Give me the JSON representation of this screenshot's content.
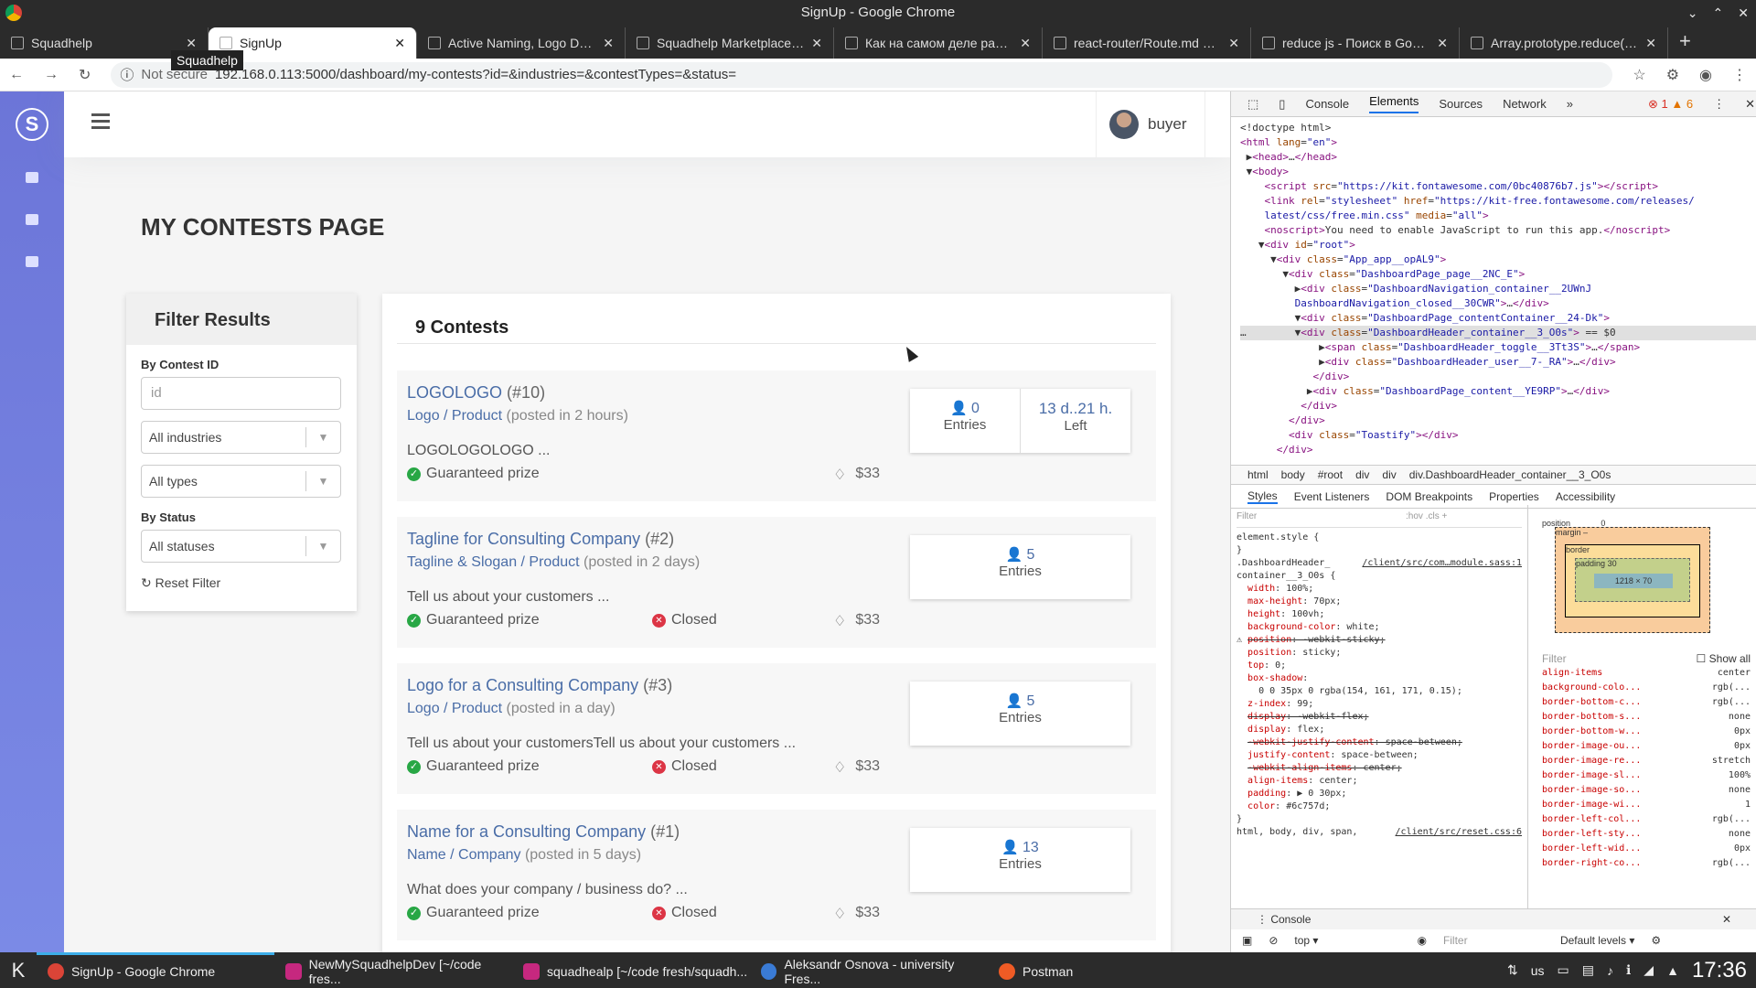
{
  "window": {
    "title": "SignUp - Google Chrome"
  },
  "tabs": [
    {
      "label": "Squadhelp"
    },
    {
      "label": "SignUp"
    },
    {
      "label": "Active Naming, Logo Desig"
    },
    {
      "label": "Squadhelp Marketplace Lis"
    },
    {
      "label": "Как на самом деле работа"
    },
    {
      "label": "react-router/Route.md at m"
    },
    {
      "label": "reduce js - Поиск в Google"
    },
    {
      "label": "Array.prototype.reduce() - J"
    }
  ],
  "tooltip": "Squadhelp",
  "address": {
    "security": "Not secure",
    "url": "192.168.0.113:5000/dashboard/my-contests?id=&industries=&contestTypes=&status="
  },
  "header": {
    "user": "buyer"
  },
  "page": {
    "title": "MY CONTESTS PAGE"
  },
  "filter": {
    "title": "Filter Results",
    "by_id_label": "By Contest ID",
    "id_placeholder": "id",
    "industries": "All industries",
    "types": "All types",
    "by_status_label": "By Status",
    "status": "All statuses",
    "reset": "Reset Filter"
  },
  "contests": {
    "count_label": "9 Contests",
    "items": [
      {
        "title": "LOGOLOGO",
        "num": "(#10)",
        "type": "Logo / Product",
        "posted": "(posted in 2 hours)",
        "desc": "LOGOLOGOLOGO ...",
        "guaranteed": "Guaranteed prize",
        "closed": "",
        "prize": "$33",
        "entries": "0",
        "entries_label": "Entries",
        "left": "13 d..21 h.",
        "left_label": "Left"
      },
      {
        "title": "Tagline for Consulting Company",
        "num": "(#2)",
        "type": "Tagline & Slogan / Product",
        "posted": "(posted in 2 days)",
        "desc": "Tell us about your customers ...",
        "guaranteed": "Guaranteed prize",
        "closed": "Closed",
        "prize": "$33",
        "entries": "5",
        "entries_label": "Entries"
      },
      {
        "title": "Logo for a Consulting Company",
        "num": "(#3)",
        "type": "Logo / Product",
        "posted": "(posted in a day)",
        "desc": "Tell us about your customersTell us about your customers ...",
        "guaranteed": "Guaranteed prize",
        "closed": "Closed",
        "prize": "$33",
        "entries": "5",
        "entries_label": "Entries"
      },
      {
        "title": "Name for a Consulting Company",
        "num": "(#1)",
        "type": "Name / Company",
        "posted": "(posted in 5 days)",
        "desc": "What does your company / business do? ...",
        "guaranteed": "Guaranteed prize",
        "closed": "Closed",
        "prize": "$33",
        "entries": "13",
        "entries_label": "Entries"
      }
    ]
  },
  "devtools": {
    "tabs": [
      "Console",
      "Elements",
      "Sources",
      "Network"
    ],
    "errors": "1",
    "warnings": "6",
    "breadcrumbs": [
      "html",
      "body",
      "#root",
      "div",
      "div",
      "div.DashboardHeader_container__3_O0s"
    ],
    "style_tabs": [
      "Styles",
      "Event Listeners",
      "DOM Breakpoints",
      "Properties",
      "Accessibility"
    ],
    "filter_placeholder": "Filter",
    "hov": ":hov",
    "cls": ".cls",
    "box": {
      "position": "position",
      "margin": "margin",
      "border": "border",
      "padding": "padding",
      "content": "1218 × 70",
      "side": "30",
      "zero": "0",
      "dash": "–"
    },
    "show_all": "Show all",
    "computed": [
      [
        "align-items",
        "center"
      ],
      [
        "background-colo...",
        "rgb(..."
      ],
      [
        "border-bottom-c...",
        "rgb(..."
      ],
      [
        "border-bottom-s...",
        "none"
      ],
      [
        "border-bottom-w...",
        "0px"
      ],
      [
        "border-image-ou...",
        "0px"
      ],
      [
        "border-image-re...",
        "stretch"
      ],
      [
        "border-image-sl...",
        "100%"
      ],
      [
        "border-image-so...",
        "none"
      ],
      [
        "border-image-wi...",
        "1"
      ],
      [
        "border-left-col...",
        "rgb(..."
      ],
      [
        "border-left-sty...",
        "none"
      ],
      [
        "border-left-wid...",
        "0px"
      ],
      [
        "border-right-co...",
        "rgb(..."
      ]
    ],
    "console_label": "Console",
    "context": "top",
    "levels": "Default levels"
  },
  "taskbar": {
    "items": [
      "SignUp - Google Chrome",
      "NewMySquadhelpDev [~/code fres...",
      "squadhealp [~/code fresh/squadh...",
      "Aleksandr Osnova - university Fres...",
      "Postman"
    ],
    "lang": "us",
    "clock": "17:36"
  }
}
